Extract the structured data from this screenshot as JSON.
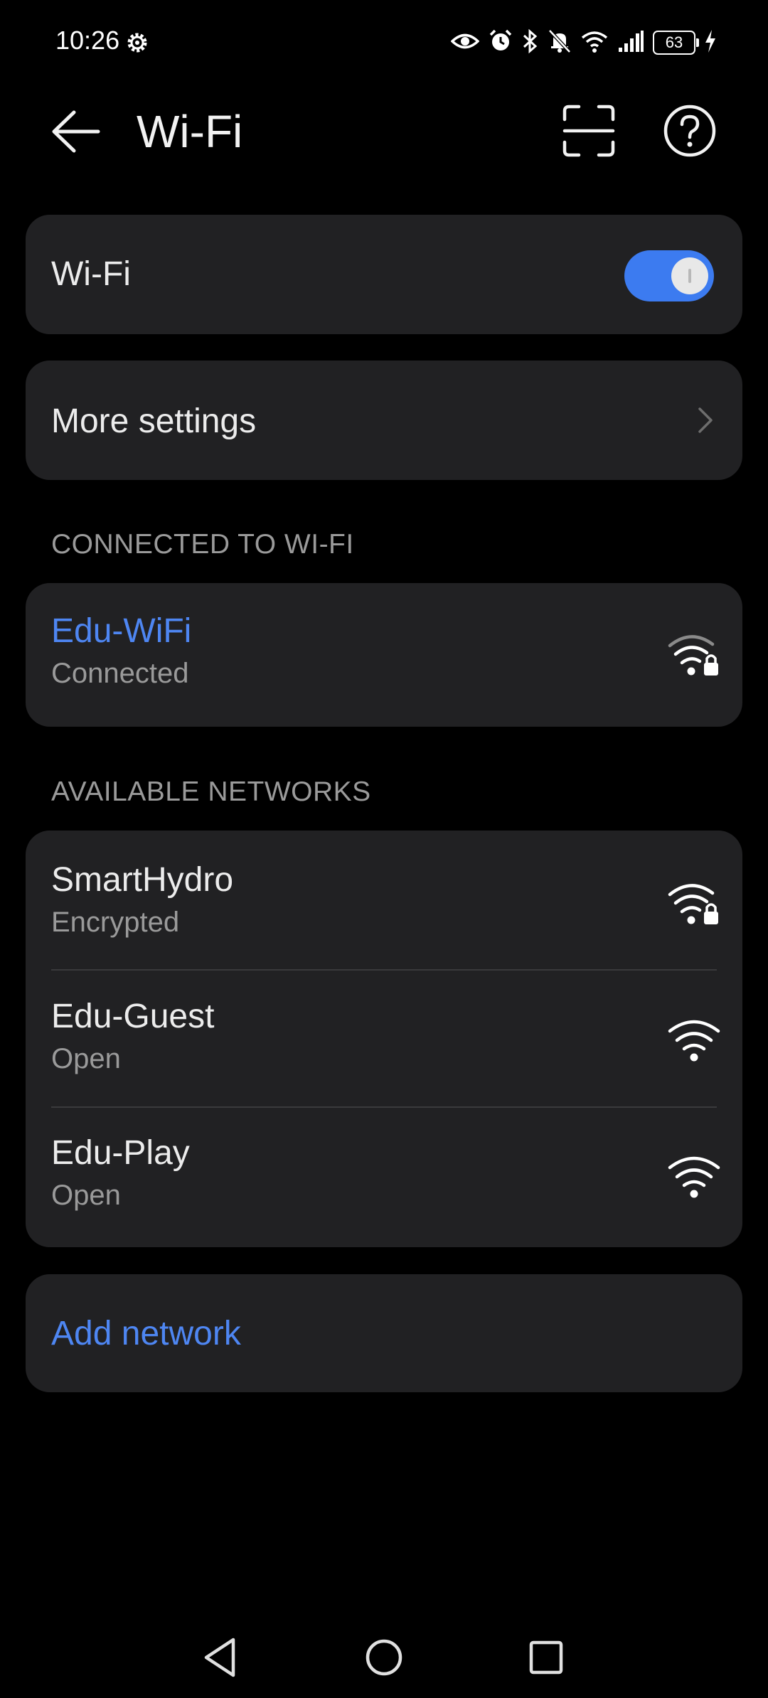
{
  "status_bar": {
    "time": "10:26",
    "battery": "63",
    "icons": [
      "settings-gear-icon",
      "eye-icon",
      "alarm-icon",
      "bluetooth-icon",
      "mute-icon",
      "wifi-icon",
      "signal-icon",
      "battery-icon",
      "charging-icon"
    ]
  },
  "header": {
    "title": "Wi-Fi",
    "icons": [
      "back-arrow-icon",
      "scan-icon",
      "help-icon"
    ]
  },
  "wifi_toggle": {
    "label": "Wi-Fi",
    "enabled": true
  },
  "more_settings": {
    "label": "More settings"
  },
  "connected_section": {
    "header": "CONNECTED TO WI-FI",
    "network": {
      "name": "Edu-WiFi",
      "status": "Connected",
      "secured": true
    }
  },
  "available_section": {
    "header": "AVAILABLE NETWORKS",
    "networks": [
      {
        "name": "SmartHydro",
        "status": "Encrypted",
        "secured": true
      },
      {
        "name": "Edu-Guest",
        "status": "Open",
        "secured": false
      },
      {
        "name": "Edu-Play",
        "status": "Open",
        "secured": false
      }
    ]
  },
  "add_network": {
    "label": "Add network"
  },
  "colors": {
    "accent": "#4e86f2",
    "toggle_on": "#3c7bf0",
    "card": "#212123",
    "background": "#000000"
  },
  "nav_bar": {
    "buttons": [
      "back-triangle-icon",
      "home-circle-icon",
      "recents-square-icon"
    ]
  }
}
